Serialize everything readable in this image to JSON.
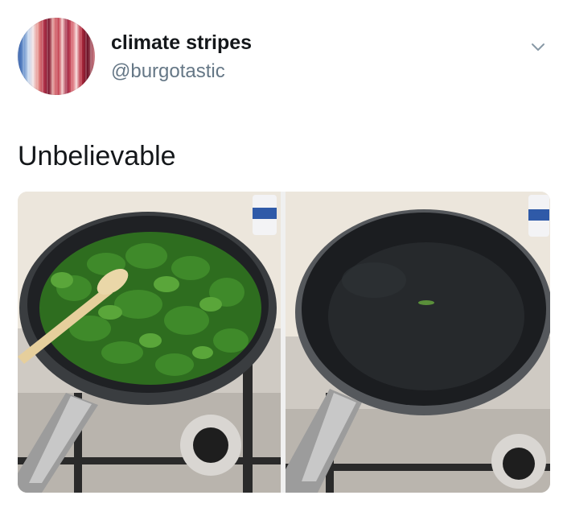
{
  "user": {
    "display_name": "climate stripes",
    "handle": "@burgotastic",
    "avatar_icon": "climate-stripes-avatar"
  },
  "menu": {
    "icon": "chevron-down-icon"
  },
  "tweet": {
    "text": "Unbelievable"
  },
  "media": {
    "photos": [
      {
        "icon": "pan-with-spinach-photo"
      },
      {
        "icon": "empty-pan-photo"
      }
    ]
  }
}
